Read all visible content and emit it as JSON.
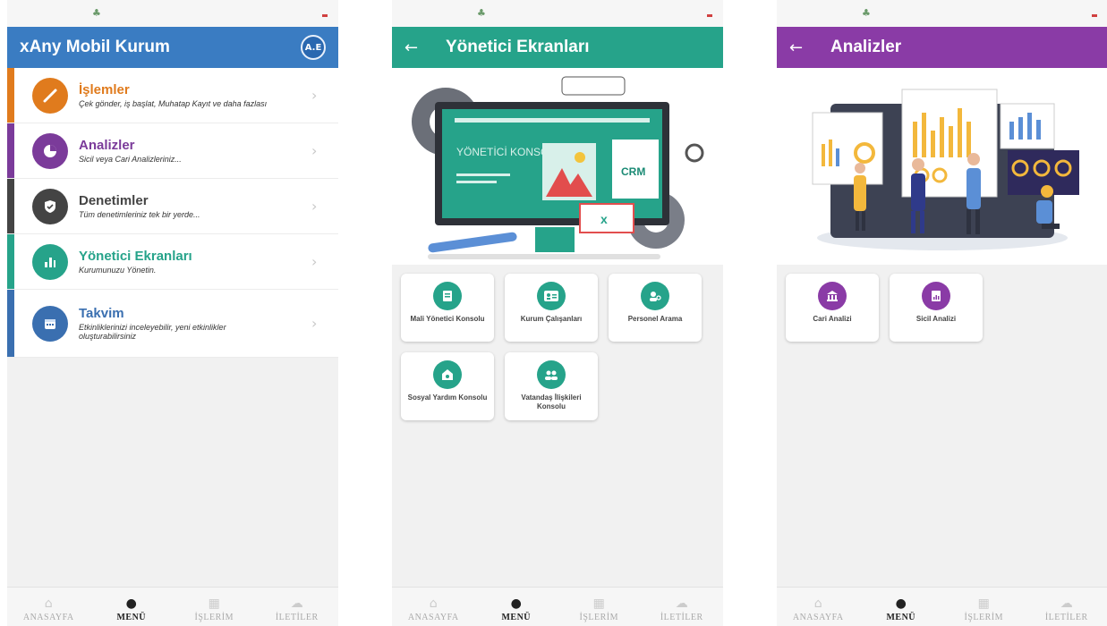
{
  "screen1": {
    "appbar_title": "xAny Mobil Kurum",
    "avatar_initials": "A.E",
    "colors": {
      "appbar": "#3a7cc2"
    },
    "menu": [
      {
        "title": "İşlemler",
        "subtitle": "Çek gönder, iş başlat, Muhatap Kayıt ve daha fazlası",
        "color": "#e07b1d",
        "icon": "pencil-icon"
      },
      {
        "title": "Analizler",
        "subtitle": "Sicil veya Cari Analizleriniz...",
        "color": "#7b3b9a",
        "icon": "pie-chart-icon"
      },
      {
        "title": "Denetimler",
        "subtitle": "Tüm denetimleriniz tek bir yerde...",
        "color": "#444444",
        "icon": "shield-icon"
      },
      {
        "title": "Yönetici Ekranları",
        "subtitle": "Kurumunuzu Yönetin.",
        "color": "#26a38a",
        "icon": "bar-chart-icon"
      },
      {
        "title": "Takvim",
        "subtitle": "Etkinliklerinizi inceleyebilir, yeni etkinlikler oluşturabilirsiniz",
        "color": "#3a6fb0",
        "icon": "calendar-icon"
      }
    ]
  },
  "screen2": {
    "appbar_title": "Yönetici Ekranları",
    "colors": {
      "appbar": "#26a38a"
    },
    "illustration": {
      "screen_text": "YÖNETİCİ KONSOLU",
      "doc_text": "CRM"
    },
    "tiles": [
      {
        "label": "Mali Yönetici Konsolu",
        "icon": "document-icon"
      },
      {
        "label": "Kurum Çalışanları",
        "icon": "id-card-icon"
      },
      {
        "label": "Personel Arama",
        "icon": "person-search-icon"
      },
      {
        "label": "Sosyal Yardım Konsolu",
        "icon": "home-heart-icon"
      },
      {
        "label": "Vatandaş İlişkileri Konsolu",
        "icon": "people-icon"
      }
    ]
  },
  "screen3": {
    "appbar_title": "Analizler",
    "colors": {
      "appbar": "#8a3ba6"
    },
    "tiles": [
      {
        "label": "Cari Analizi",
        "icon": "bank-icon"
      },
      {
        "label": "Sicil Analizi",
        "icon": "report-icon"
      }
    ]
  },
  "nav": {
    "items": [
      "ANASAYFA",
      "MENÜ",
      "İŞLERİM",
      "İLETİLER"
    ],
    "active_index": 1
  }
}
